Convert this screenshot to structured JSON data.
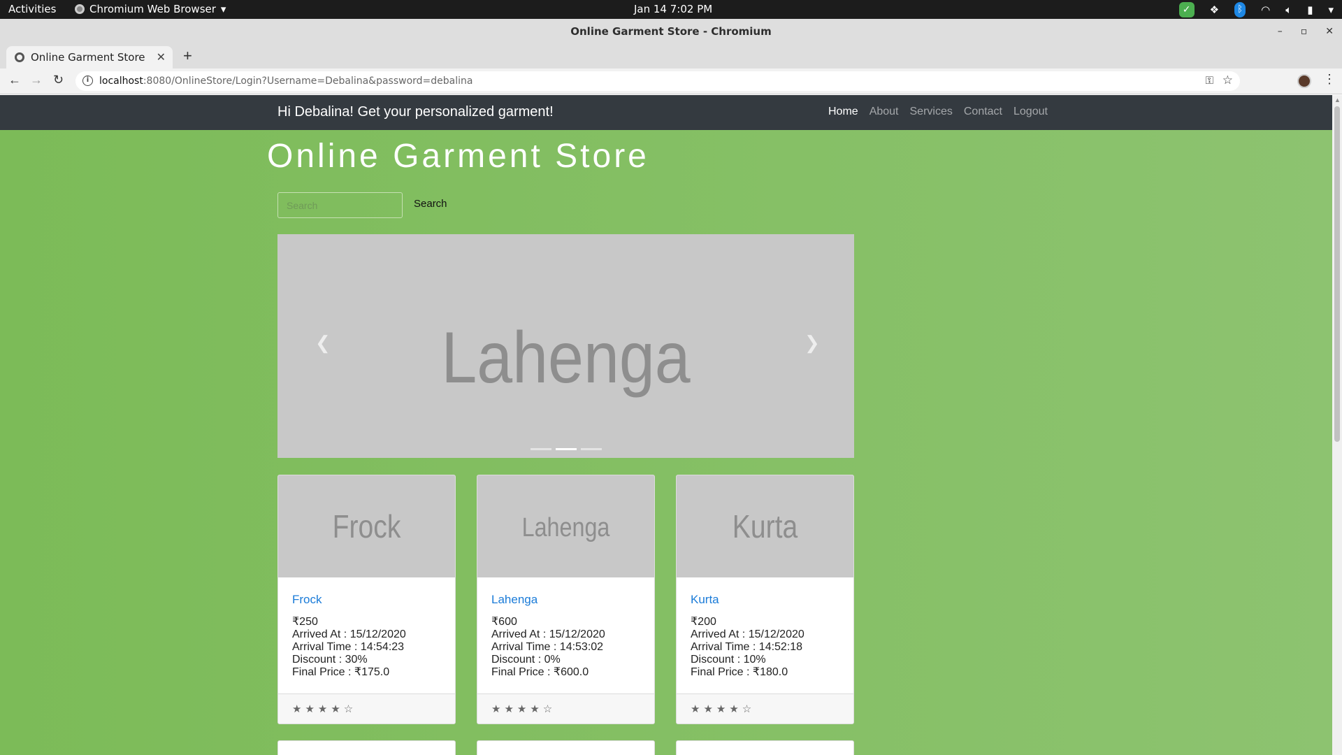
{
  "os_bar": {
    "activities": "Activities",
    "app_menu": "Chromium Web Browser",
    "clock": "Jan 14  7:02 PM"
  },
  "window": {
    "title": "Online Garment Store - Chromium"
  },
  "browser": {
    "tab_title": "Online Garment Store",
    "url_host": "localhost",
    "url_rest": ":8080/OnlineStore/Login?Username=Debalina&password=debalina"
  },
  "site": {
    "greeting": "Hi Debalina! Get your personalized garment!",
    "nav": [
      "Home",
      "About",
      "Services",
      "Contact",
      "Logout"
    ],
    "active_nav": "Home",
    "store_title": "Online Garment Store",
    "search_placeholder": "Search",
    "search_button": "Search",
    "background_color": "#86c066",
    "navbar_color": "#343a40",
    "link_color": "#1a7bd8"
  },
  "carousel": {
    "current_slide_text": "Lahenga",
    "slide_count": 3,
    "active_index": 1
  },
  "products": [
    {
      "image_text": "Frock",
      "name": "Frock",
      "price": "₹250",
      "arrived_at": "Arrived At : 15/12/2020",
      "arrival_time": "Arrival Time : 14:54:23",
      "discount": "Discount : 30%",
      "final_price": "Final Price : ₹175.0",
      "stars": "★★★★☆",
      "rating": 4
    },
    {
      "image_text": "Lahenga",
      "name": "Lahenga",
      "price": "₹600",
      "arrived_at": "Arrived At : 15/12/2020",
      "arrival_time": "Arrival Time : 14:53:02",
      "discount": "Discount : 0%",
      "final_price": "Final Price : ₹600.0",
      "stars": "★★★★☆",
      "rating": 4
    },
    {
      "image_text": "Kurta",
      "name": "Kurta",
      "price": "₹200",
      "arrived_at": "Arrived At : 15/12/2020",
      "arrival_time": "Arrival Time : 14:52:18",
      "discount": "Discount : 10%",
      "final_price": "Final Price : ₹180.0",
      "stars": "★★★★☆",
      "rating": 4
    }
  ]
}
